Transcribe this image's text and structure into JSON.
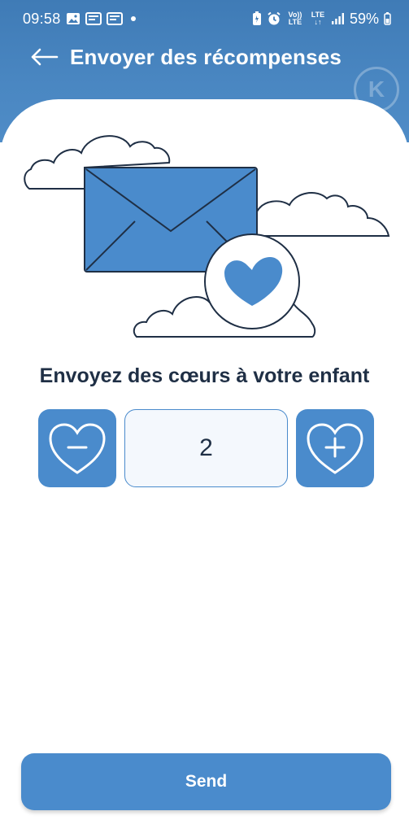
{
  "status_bar": {
    "time": "09:58",
    "battery": "59%",
    "left_icons": [
      "gallery-icon",
      "notification-icon",
      "notification-icon",
      "dot-icon"
    ],
    "right_icons": [
      "battery-saver-icon",
      "alarm-icon",
      "volte-icon",
      "lte-icon",
      "signal-icon",
      "battery-icon"
    ],
    "volte_label": "Vo)) LTE",
    "lte_label": "LTE ↓↑"
  },
  "header": {
    "title": "Envoyer des récompenses",
    "back_icon": "arrow-left-icon",
    "logo_letter": "K"
  },
  "main": {
    "headline": "Envoyez des cœurs à votre enfant",
    "stepper": {
      "value": "2",
      "decrement_icon": "heart-minus-icon",
      "increment_icon": "heart-plus-icon"
    },
    "illustration_icon": "envelope-heart-icon"
  },
  "footer": {
    "send_label": "Send"
  },
  "colors": {
    "primary": "#4a8bcc",
    "header": "#3f7bb6",
    "text_dark": "#1f2f45",
    "outline": "#1f2f45"
  }
}
